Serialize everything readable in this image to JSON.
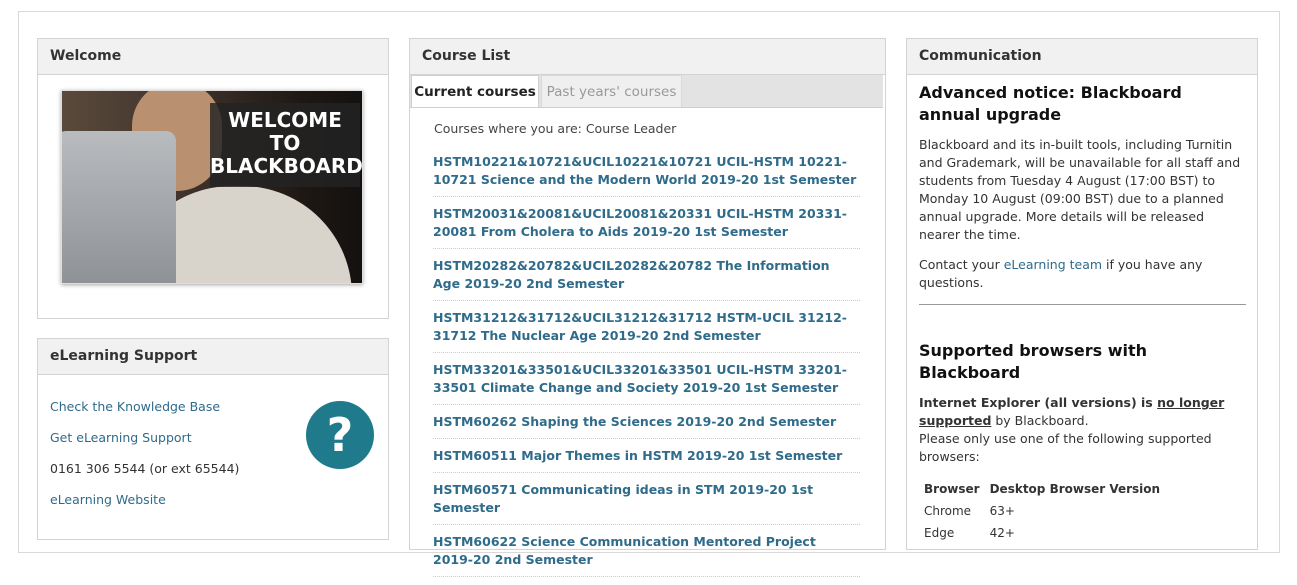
{
  "welcome": {
    "title": "Welcome",
    "banner_line1": "WELCOME",
    "banner_line2": "TO",
    "banner_line3": "BLACKBOARD"
  },
  "support": {
    "title": "eLearning Support",
    "links": [
      "Check the Knowledge Base",
      "Get eLearning Support"
    ],
    "phone": "0161 306 5544 (or ext 65544)",
    "website": "eLearning Website",
    "help_icon": "question-mark-icon",
    "help_glyph": "?"
  },
  "courses": {
    "title": "Course List",
    "tabs": [
      "Current courses",
      "Past years' courses"
    ],
    "role_text": "Courses where you are: Course Leader",
    "items": [
      "HSTM10221&10721&UCIL10221&10721 UCIL-HSTM 10221-10721 Science and the Modern World 2019-20 1st Semester",
      "HSTM20031&20081&UCIL20081&20331 UCIL-HSTM 20331-20081 From Cholera to Aids 2019-20 1st Semester",
      "HSTM20282&20782&UCIL20282&20782 The Information Age 2019-20 2nd Semester",
      "HSTM31212&31712&UCIL31212&31712 HSTM-UCIL 31212-31712 The Nuclear Age 2019-20 2nd Semester",
      "HSTM33201&33501&UCIL33201&33501 UCIL-HSTM 33201-33501 Climate Change and Society 2019-20 1st Semester",
      "HSTM60262 Shaping the Sciences 2019-20 2nd Semester",
      "HSTM60511 Major Themes in HSTM 2019-20 1st Semester",
      "HSTM60571 Communicating ideas in STM 2019-20 1st Semester",
      "HSTM60622 Science Communication Mentored Project 2019-20 2nd Semester"
    ]
  },
  "communication": {
    "title": "Communication",
    "notice_heading": "Advanced notice: Blackboard annual upgrade",
    "notice_body": "Blackboard and its in-built tools, including Turnitin and Grademark, will be unavailable for all staff and students from Tuesday 4 August (17:00 BST) to Monday 10 August (09:00 BST) due to a planned annual upgrade. More details will be released nearer the time.",
    "contact_prefix": "Contact your ",
    "contact_link": "eLearning team",
    "contact_suffix": " if you have any questions.",
    "browsers_heading": "Supported browsers with Blackboard",
    "ie_prefix": "Internet Explorer (all versions) is ",
    "ie_underlined": "no longer supported",
    "ie_suffix": " by Blackboard.",
    "use_text": "Please only use one of the following supported browsers:",
    "table_headers": [
      "Browser",
      "Desktop Browser Version"
    ],
    "table_rows": [
      [
        "Chrome",
        "63+"
      ],
      [
        "Edge",
        "42+"
      ]
    ]
  }
}
